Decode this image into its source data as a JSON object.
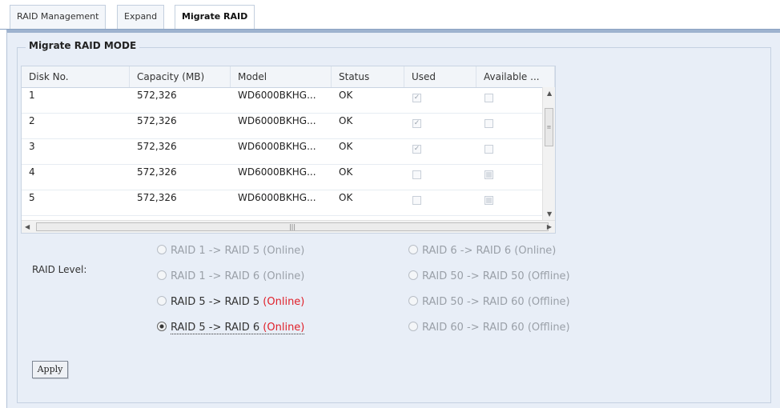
{
  "tabs": [
    {
      "label": "RAID Management",
      "active": false
    },
    {
      "label": "Expand",
      "active": false
    },
    {
      "label": "Migrate RAID",
      "active": true
    }
  ],
  "section": {
    "title": "Migrate RAID MODE"
  },
  "table": {
    "columns": [
      "Disk No.",
      "Capacity (MB)",
      "Model",
      "Status",
      "Used",
      "Available ..."
    ],
    "rows": [
      {
        "disk": "1",
        "capacity": "572,326",
        "model": "WD6000BKHG...",
        "status": "OK",
        "used": true,
        "available": false
      },
      {
        "disk": "2",
        "capacity": "572,326",
        "model": "WD6000BKHG...",
        "status": "OK",
        "used": true,
        "available": false
      },
      {
        "disk": "3",
        "capacity": "572,326",
        "model": "WD6000BKHG...",
        "status": "OK",
        "used": true,
        "available": false
      },
      {
        "disk": "4",
        "capacity": "572,326",
        "model": "WD6000BKHG...",
        "status": "OK",
        "used": false,
        "available": true
      },
      {
        "disk": "5",
        "capacity": "572,326",
        "model": "WD6000BKHG...",
        "status": "OK",
        "used": false,
        "available": true
      }
    ]
  },
  "raid_level": {
    "label": "RAID Level:",
    "options": [
      {
        "text": "RAID 1 -> RAID 5",
        "mode": "(Online)",
        "enabled": false,
        "selected": false
      },
      {
        "text": "RAID 1 -> RAID 6",
        "mode": "(Online)",
        "enabled": false,
        "selected": false
      },
      {
        "text": "RAID 5 -> RAID 5",
        "mode": "(Online)",
        "enabled": true,
        "selected": false
      },
      {
        "text": "RAID 5 -> RAID 6",
        "mode": "(Online)",
        "enabled": true,
        "selected": true
      },
      {
        "text": "RAID 6 -> RAID 6",
        "mode": "(Online)",
        "enabled": false,
        "selected": false
      },
      {
        "text": "RAID 50 -> RAID 50",
        "mode": "(Offline)",
        "enabled": false,
        "selected": false
      },
      {
        "text": "RAID 50 -> RAID 60",
        "mode": "(Offline)",
        "enabled": false,
        "selected": false
      },
      {
        "text": "RAID 60 -> RAID 60",
        "mode": "(Offline)",
        "enabled": false,
        "selected": false
      }
    ]
  },
  "apply_label": "Apply",
  "icons": {
    "scroll_up": "up-arrow-icon",
    "scroll_down": "down-arrow-icon",
    "scroll_left": "left-arrow-icon",
    "scroll_right": "right-arrow-icon"
  },
  "colors": {
    "online_enabled": "#e0202a",
    "panel_bg": "#e8eef7",
    "tab_line": "#8aa2c2"
  }
}
